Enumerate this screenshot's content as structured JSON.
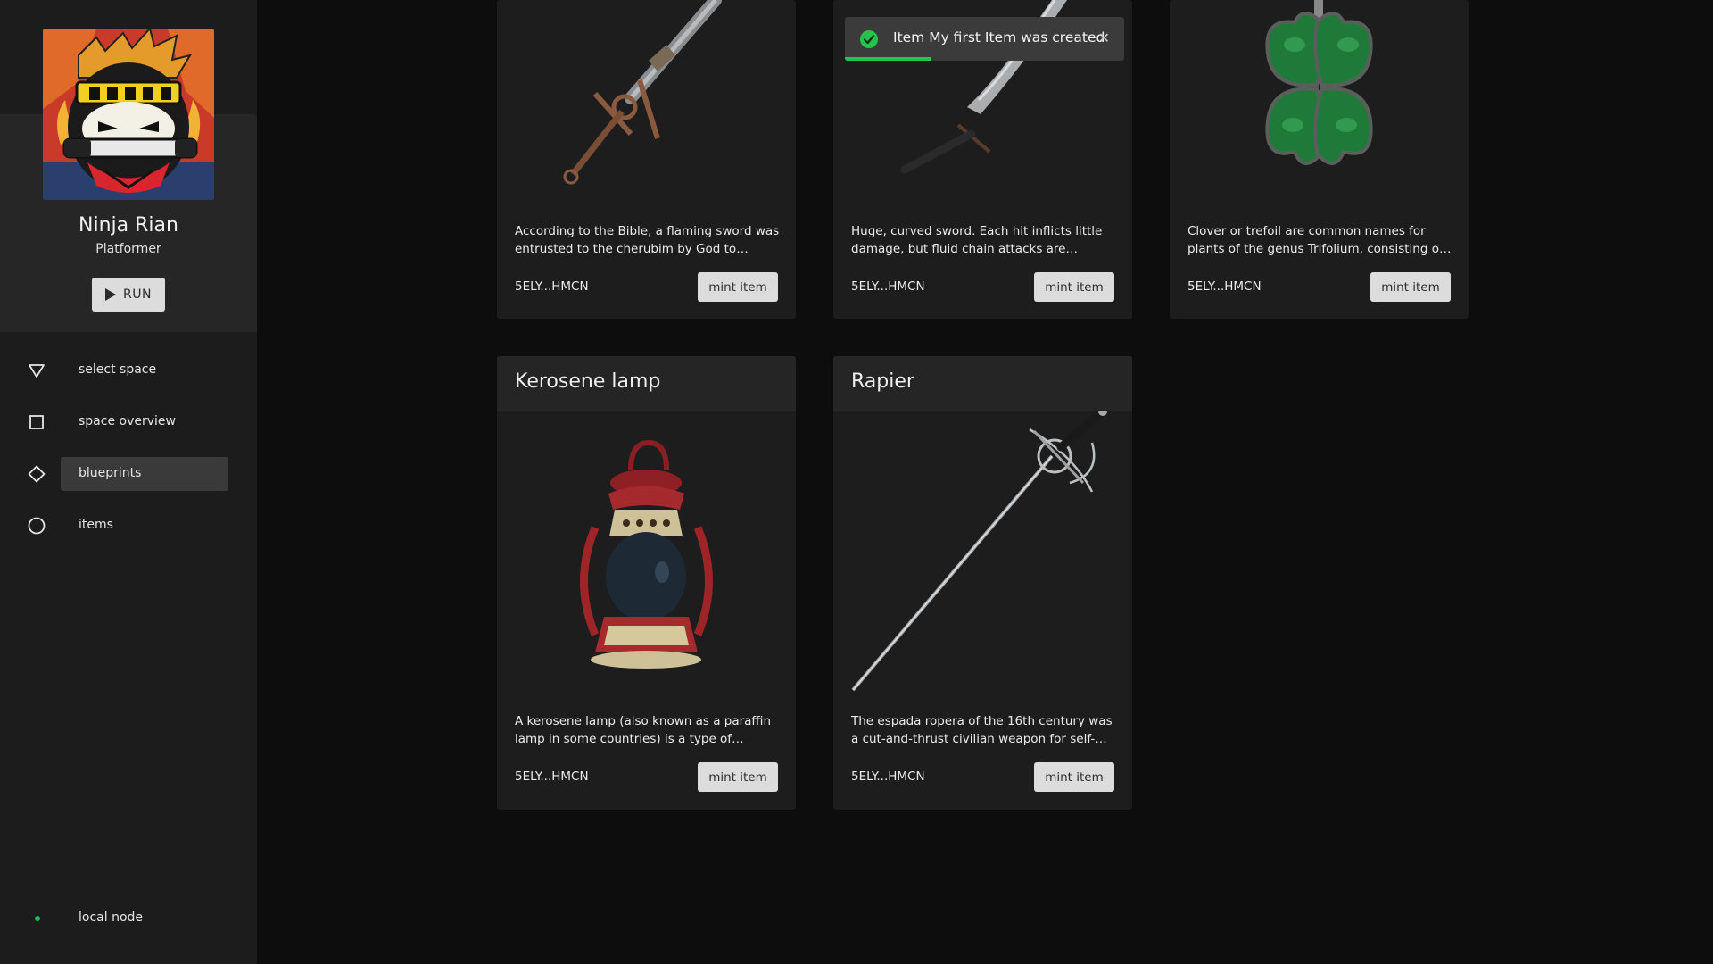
{
  "space": {
    "name": "Ninja Rian",
    "genre": "Platformer",
    "run_label": "RUN"
  },
  "nav": {
    "items": [
      {
        "label": "select space",
        "icon": "triangle-down-icon"
      },
      {
        "label": "space overview",
        "icon": "square-icon"
      },
      {
        "label": "blueprints",
        "icon": "diamond-icon",
        "active": true
      },
      {
        "label": "items",
        "icon": "circle-icon"
      }
    ]
  },
  "node": {
    "label": "local node",
    "status_color": "#1db954"
  },
  "toast": {
    "message": "Item My first Item was created",
    "close_glyph": "✕",
    "progress": 0.31,
    "accent": "#27c24c"
  },
  "cards": [
    {
      "image": "flaming-sword",
      "description": "According to the Bible, a flaming sword was entrusted to the cherubim by God to guard…",
      "owner": "5ELY...HMCN",
      "button": "mint item"
    },
    {
      "image": "curved-sword",
      "description": "Huge, curved sword. Each hit inflicts little damage, but fluid chain attacks are deadly.\"…",
      "owner": "5ELY...HMCN",
      "button": "mint item"
    },
    {
      "image": "four-leaf-clover",
      "description": "Clover or trefoil are common names for plants of the genus Trifolium, consisting of about…",
      "owner": "5ELY...HMCN",
      "button": "mint item"
    },
    {
      "title": "Kerosene lamp",
      "image": "kerosene-lamp",
      "description": "A kerosene lamp (also known as a paraffin lamp in some countries) is a type of lighting…",
      "owner": "5ELY...HMCN",
      "button": "mint item"
    },
    {
      "title": "Rapier",
      "image": "rapier",
      "description": "The espada ropera of the 16th century was a cut-and-thrust civilian weapon for self-…",
      "owner": "5ELY...HMCN",
      "button": "mint item"
    }
  ]
}
